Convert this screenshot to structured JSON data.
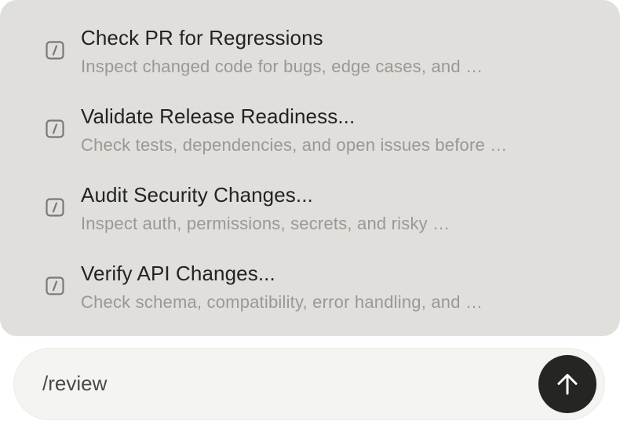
{
  "commands": [
    {
      "icon": "slash-command-icon",
      "title": "Check PR for Regressions",
      "description": "Inspect changed code for bugs, edge cases, and …"
    },
    {
      "icon": "slash-command-icon",
      "title": "Validate Release Readiness...",
      "description": "Check tests, dependencies, and open issues before …"
    },
    {
      "icon": "slash-command-icon",
      "title": "Audit Security Changes...",
      "description": "Inspect auth, permissions, secrets, and risky …"
    },
    {
      "icon": "slash-command-icon",
      "title": "Verify API Changes...",
      "description": "Check schema, compatibility, error handling, and …"
    }
  ],
  "composer": {
    "value": "/review",
    "send_icon": "arrow-up-icon"
  },
  "colors": {
    "menu_background": "#e0dfdb",
    "composer_background": "#f4f4f0",
    "send_button": "#252523",
    "title_text": "#232321",
    "description_text": "#9a9894"
  }
}
